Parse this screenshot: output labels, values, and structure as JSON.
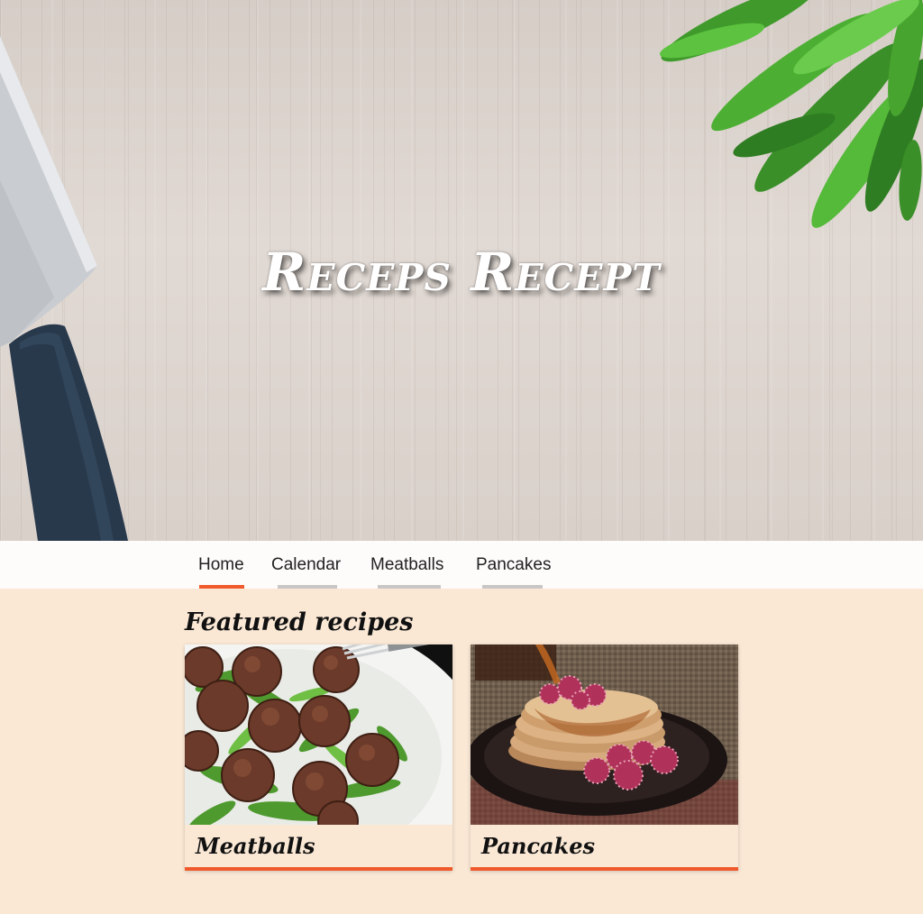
{
  "hero": {
    "title": "Receps Recept"
  },
  "nav": {
    "items": [
      {
        "label": "Home",
        "active": true
      },
      {
        "label": "Calendar",
        "active": false
      },
      {
        "label": "Meatballs",
        "active": false
      },
      {
        "label": "Pancakes",
        "active": false
      }
    ]
  },
  "featured": {
    "heading": "Featured recipes",
    "cards": [
      {
        "title": "Meatballs",
        "image": "meatballs-photo"
      },
      {
        "title": "Pancakes",
        "image": "pancakes-photo"
      }
    ]
  },
  "colors": {
    "accent": "#f0592b",
    "page_background": "#fae8d5",
    "nav_background": "#fdfcfb",
    "inactive_underline": "#c9c6c6"
  }
}
